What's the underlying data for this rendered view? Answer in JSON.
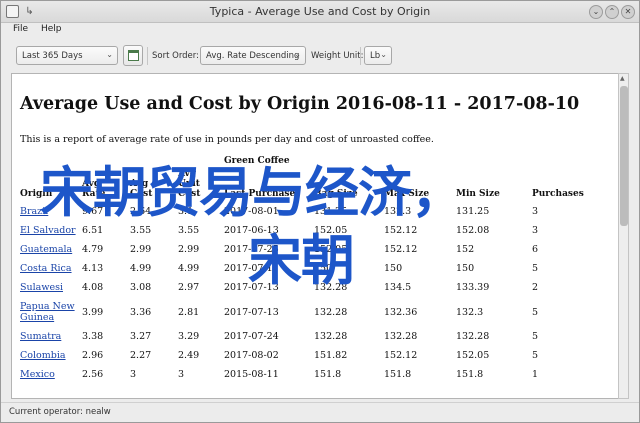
{
  "window": {
    "title": "Typica - Average Use and Cost by Origin",
    "pin_glyph": "↳",
    "min_glyph": "⌄",
    "max_glyph": "⌃",
    "close_glyph": "✕"
  },
  "menu": {
    "file": "File",
    "help": "Help"
  },
  "toolbar": {
    "date_range": "Last 365 Days",
    "sort_label": "Sort Order:",
    "sort_value": "Avg. Rate Descending",
    "weight_label": "Weight Unit:",
    "weight_value": "Lb",
    "arrow_glyph": "⌄"
  },
  "report": {
    "title": "Average Use and Cost by Origin 2016-08-11 - 2017-08-10",
    "description": "This is a report of average rate of use in pounds per day and cost of unroasted coffee.",
    "group_header": "Green Coffee",
    "columns": {
      "origin": "Origin",
      "avg_rate": "Avg Rate",
      "avg_cost": "Avg Cost",
      "avg_unit": "Avg Unit Cost",
      "last_purchase": "Last Purchase",
      "bag_size": "Bag Size",
      "max_size": "Max Size",
      "min_size": "Min Size",
      "purchases": "Purchases"
    },
    "rows": [
      {
        "origin": "Brazil",
        "avg_rate": "9.67",
        "avg_cost": "2.64",
        "avg_unit": "3.1",
        "last_purchase": "2017-08-01",
        "bag_size": "131.25",
        "max_size": "132.3",
        "min_size": "131.25",
        "purchases": "3"
      },
      {
        "origin": "El Salvador",
        "avg_rate": "6.51",
        "avg_cost": "3.55",
        "avg_unit": "3.55",
        "last_purchase": "2017-06-13",
        "bag_size": "152.05",
        "max_size": "152.12",
        "min_size": "152.08",
        "purchases": "3"
      },
      {
        "origin": "Guatemala",
        "avg_rate": "4.79",
        "avg_cost": "2.99",
        "avg_unit": "2.99",
        "last_purchase": "2017-07-25",
        "bag_size": "152.05",
        "max_size": "152.12",
        "min_size": "152",
        "purchases": "6"
      },
      {
        "origin": "Costa Rica",
        "avg_rate": "4.13",
        "avg_cost": "4.99",
        "avg_unit": "4.99",
        "last_purchase": "2017-07-11",
        "bag_size": "150",
        "max_size": "150",
        "min_size": "150",
        "purchases": "5"
      },
      {
        "origin": "Sulawesi",
        "avg_rate": "4.08",
        "avg_cost": "3.08",
        "avg_unit": "2.97",
        "last_purchase": "2017-07-13",
        "bag_size": "132.28",
        "max_size": "134.5",
        "min_size": "133.39",
        "purchases": "2"
      },
      {
        "origin": "Papua New Guinea",
        "avg_rate": "3.99",
        "avg_cost": "3.36",
        "avg_unit": "2.81",
        "last_purchase": "2017-07-13",
        "bag_size": "132.28",
        "max_size": "132.36",
        "min_size": "132.3",
        "purchases": "5"
      },
      {
        "origin": "Sumatra",
        "avg_rate": "3.38",
        "avg_cost": "3.27",
        "avg_unit": "3.29",
        "last_purchase": "2017-07-24",
        "bag_size": "132.28",
        "max_size": "132.28",
        "min_size": "132.28",
        "purchases": "5"
      },
      {
        "origin": "Colombia",
        "avg_rate": "2.96",
        "avg_cost": "2.27",
        "avg_unit": "2.49",
        "last_purchase": "2017-08-02",
        "bag_size": "151.82",
        "max_size": "152.12",
        "min_size": "152.05",
        "purchases": "5"
      },
      {
        "origin": "Mexico",
        "avg_rate": "2.56",
        "avg_cost": "3",
        "avg_unit": "3",
        "last_purchase": "2015-08-11",
        "bag_size": "151.8",
        "max_size": "151.8",
        "min_size": "151.8",
        "purchases": "1"
      }
    ]
  },
  "overlay": {
    "line1": "宋朝贸易与经济，",
    "line2": "宋朝"
  },
  "status": {
    "operator": "Current operator: nealw"
  },
  "colors": {
    "link": "#1a44a8",
    "overlay_text": "#1d56c9"
  }
}
